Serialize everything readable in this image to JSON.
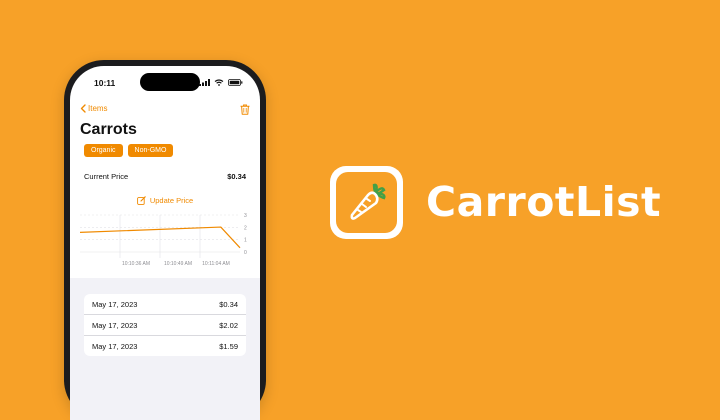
{
  "status_bar": {
    "time": "10:11"
  },
  "nav": {
    "back_label": "Items"
  },
  "item": {
    "title": "Carrots",
    "tags": [
      "Organic",
      "Non-GMO"
    ],
    "current_price_label": "Current Price",
    "current_price_value": "$0.34",
    "update_price_label": "Update Price"
  },
  "chart_data": {
    "type": "line",
    "x": [
      "10:10:30 AM",
      "10:10:49 AM",
      "10:11:04 AM"
    ],
    "x_tick_labels": [
      "10:10:36 AM",
      "10:10:49 AM",
      "10:11:04 AM"
    ],
    "series": [
      {
        "values": [
          1.59,
          2.02,
          0.34
        ]
      }
    ],
    "y_ticks": [
      "0",
      "1",
      "2",
      "3"
    ],
    "ylim": [
      0,
      3
    ],
    "grid": true,
    "line_color": "#f08a00"
  },
  "history": [
    {
      "date": "May 17, 2023",
      "price": "$0.34"
    },
    {
      "date": "May 17, 2023",
      "price": "$2.02"
    },
    {
      "date": "May 17, 2023",
      "price": "$1.59"
    }
  ],
  "brand": {
    "app_name": "CarrotList",
    "icon": "carrot-icon"
  },
  "colors": {
    "background": "#f7a128",
    "accent": "#f08a00",
    "phone_frame": "#1c1c1e"
  },
  "icons": [
    "chevron-left-icon",
    "trash-icon",
    "edit-icon",
    "signal-icon",
    "wifi-icon",
    "battery-icon",
    "carrot-icon"
  ]
}
